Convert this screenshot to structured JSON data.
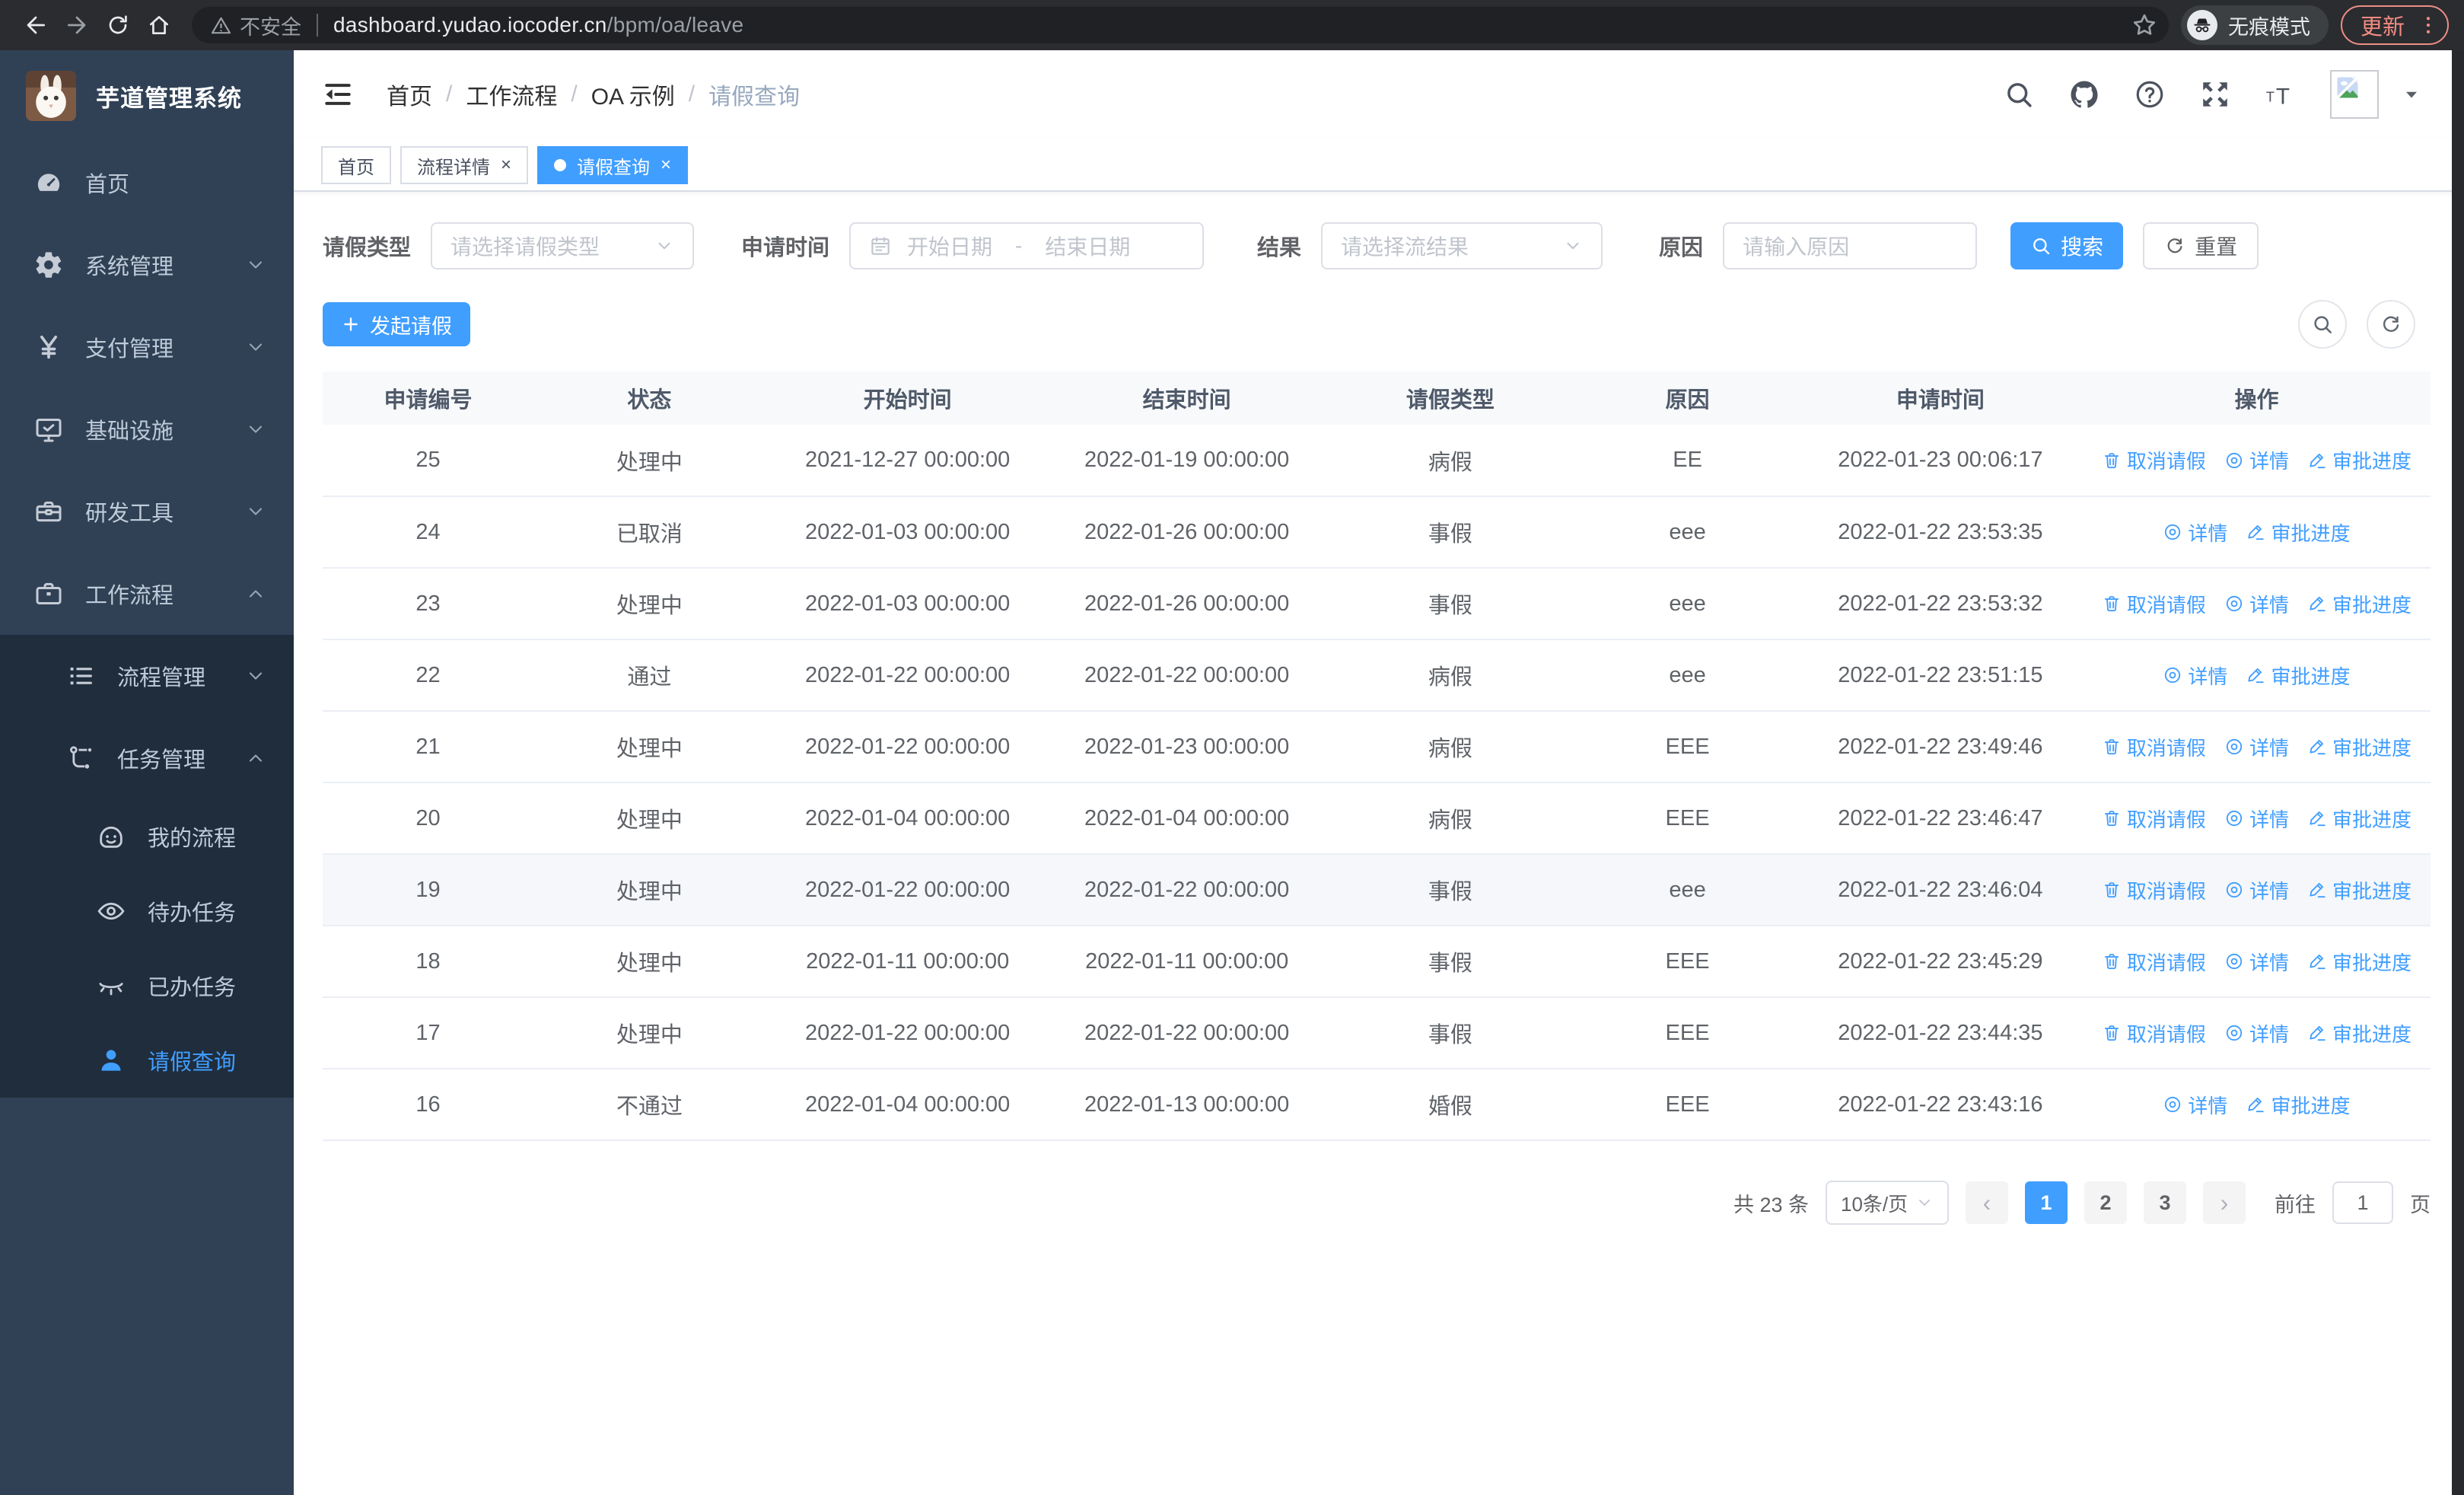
{
  "colors": {
    "primary": "#409EFF",
    "sidebar_bg": "#304156",
    "submenu_bg": "#1f2d3d",
    "update_accent": "#f28b82"
  },
  "browser": {
    "security_label": "不安全",
    "url_host": "dashboard.yudao.iocoder.cn",
    "url_path": "/bpm/oa/leave",
    "incognito_label": "无痕模式",
    "update_label": "更新"
  },
  "sidebar": {
    "title": "芋道管理系统",
    "items": [
      {
        "key": "home",
        "label": "首页",
        "icon": "dashboard-icon",
        "level": 0
      },
      {
        "key": "system",
        "label": "系统管理",
        "icon": "gear-icon",
        "level": 0,
        "chevron": "down"
      },
      {
        "key": "payment",
        "label": "支付管理",
        "icon": "yen-icon",
        "level": 0,
        "chevron": "down"
      },
      {
        "key": "infra",
        "label": "基础设施",
        "icon": "monitor-icon",
        "level": 0,
        "chevron": "down"
      },
      {
        "key": "devtools",
        "label": "研发工具",
        "icon": "toolbox-icon",
        "level": 0,
        "chevron": "down"
      },
      {
        "key": "workflow",
        "label": "工作流程",
        "icon": "briefcase-icon",
        "level": 0,
        "chevron": "up"
      },
      {
        "key": "process-mgmt",
        "label": "流程管理",
        "icon": "tree-list-icon",
        "level": 1,
        "nested": true,
        "chevron": "down"
      },
      {
        "key": "task-mgmt",
        "label": "任务管理",
        "icon": "flow-icon",
        "level": 1,
        "nested": true,
        "chevron": "up"
      },
      {
        "key": "my-process",
        "label": "我的流程",
        "icon": "face-icon",
        "level": 2,
        "nested": true
      },
      {
        "key": "todo-tasks",
        "label": "待办任务",
        "icon": "eye-open-icon",
        "level": 2,
        "nested": true
      },
      {
        "key": "done-tasks",
        "label": "已办任务",
        "icon": "eye-closed-icon",
        "level": 2,
        "nested": true
      },
      {
        "key": "leave-query",
        "label": "请假查询",
        "icon": "user-icon",
        "level": 2,
        "nested": true,
        "active": true
      }
    ]
  },
  "breadcrumb": [
    "首页",
    "工作流程",
    "OA 示例",
    "请假查询"
  ],
  "tabs": [
    {
      "label": "首页",
      "closable": false,
      "active": false
    },
    {
      "label": "流程详情",
      "closable": true,
      "active": false
    },
    {
      "label": "请假查询",
      "closable": true,
      "active": true
    }
  ],
  "filters": {
    "leave_type_label": "请假类型",
    "leave_type_placeholder": "请选择请假类型",
    "apply_time_label": "申请时间",
    "start_date_placeholder": "开始日期",
    "date_separator": "-",
    "end_date_placeholder": "结束日期",
    "result_label": "结果",
    "result_placeholder": "请选择流结果",
    "reason_label": "原因",
    "reason_placeholder": "请输入原因",
    "search_label": "搜索",
    "reset_label": "重置"
  },
  "toolbar": {
    "create_label": "发起请假"
  },
  "table": {
    "columns": [
      "申请编号",
      "状态",
      "开始时间",
      "结束时间",
      "请假类型",
      "原因",
      "申请时间",
      "操作"
    ],
    "rows": [
      {
        "id": "25",
        "status": "处理中",
        "start": "2021-12-27 00:00:00",
        "end": "2022-01-19 00:00:00",
        "type": "病假",
        "reason": "EE",
        "apply_time": "2022-01-23 00:06:17",
        "highlight": false,
        "actions": [
          {
            "label": "取消请假",
            "icon": "trash-icon"
          },
          {
            "label": "详情",
            "icon": "view-icon"
          },
          {
            "label": "审批进度",
            "icon": "progress-icon"
          }
        ]
      },
      {
        "id": "24",
        "status": "已取消",
        "start": "2022-01-03 00:00:00",
        "end": "2022-01-26 00:00:00",
        "type": "事假",
        "reason": "eee",
        "apply_time": "2022-01-22 23:53:35",
        "highlight": false,
        "actions": [
          {
            "label": "详情",
            "icon": "view-icon"
          },
          {
            "label": "审批进度",
            "icon": "progress-icon"
          }
        ]
      },
      {
        "id": "23",
        "status": "处理中",
        "start": "2022-01-03 00:00:00",
        "end": "2022-01-26 00:00:00",
        "type": "事假",
        "reason": "eee",
        "apply_time": "2022-01-22 23:53:32",
        "highlight": false,
        "actions": [
          {
            "label": "取消请假",
            "icon": "trash-icon"
          },
          {
            "label": "详情",
            "icon": "view-icon"
          },
          {
            "label": "审批进度",
            "icon": "progress-icon"
          }
        ]
      },
      {
        "id": "22",
        "status": "通过",
        "start": "2022-01-22 00:00:00",
        "end": "2022-01-22 00:00:00",
        "type": "病假",
        "reason": "eee",
        "apply_time": "2022-01-22 23:51:15",
        "highlight": false,
        "actions": [
          {
            "label": "详情",
            "icon": "view-icon"
          },
          {
            "label": "审批进度",
            "icon": "progress-icon"
          }
        ]
      },
      {
        "id": "21",
        "status": "处理中",
        "start": "2022-01-22 00:00:00",
        "end": "2022-01-23 00:00:00",
        "type": "病假",
        "reason": "EEE",
        "apply_time": "2022-01-22 23:49:46",
        "highlight": false,
        "actions": [
          {
            "label": "取消请假",
            "icon": "trash-icon"
          },
          {
            "label": "详情",
            "icon": "view-icon"
          },
          {
            "label": "审批进度",
            "icon": "progress-icon"
          }
        ]
      },
      {
        "id": "20",
        "status": "处理中",
        "start": "2022-01-04 00:00:00",
        "end": "2022-01-04 00:00:00",
        "type": "病假",
        "reason": "EEE",
        "apply_time": "2022-01-22 23:46:47",
        "highlight": false,
        "actions": [
          {
            "label": "取消请假",
            "icon": "trash-icon"
          },
          {
            "label": "详情",
            "icon": "view-icon"
          },
          {
            "label": "审批进度",
            "icon": "progress-icon"
          }
        ]
      },
      {
        "id": "19",
        "status": "处理中",
        "start": "2022-01-22 00:00:00",
        "end": "2022-01-22 00:00:00",
        "type": "事假",
        "reason": "eee",
        "apply_time": "2022-01-22 23:46:04",
        "highlight": true,
        "actions": [
          {
            "label": "取消请假",
            "icon": "trash-icon"
          },
          {
            "label": "详情",
            "icon": "view-icon"
          },
          {
            "label": "审批进度",
            "icon": "progress-icon"
          }
        ]
      },
      {
        "id": "18",
        "status": "处理中",
        "start": "2022-01-11 00:00:00",
        "end": "2022-01-11 00:00:00",
        "type": "事假",
        "reason": "EEE",
        "apply_time": "2022-01-22 23:45:29",
        "highlight": false,
        "actions": [
          {
            "label": "取消请假",
            "icon": "trash-icon"
          },
          {
            "label": "详情",
            "icon": "view-icon"
          },
          {
            "label": "审批进度",
            "icon": "progress-icon"
          }
        ]
      },
      {
        "id": "17",
        "status": "处理中",
        "start": "2022-01-22 00:00:00",
        "end": "2022-01-22 00:00:00",
        "type": "事假",
        "reason": "EEE",
        "apply_time": "2022-01-22 23:44:35",
        "highlight": false,
        "actions": [
          {
            "label": "取消请假",
            "icon": "trash-icon"
          },
          {
            "label": "详情",
            "icon": "view-icon"
          },
          {
            "label": "审批进度",
            "icon": "progress-icon"
          }
        ]
      },
      {
        "id": "16",
        "status": "不通过",
        "start": "2022-01-04 00:00:00",
        "end": "2022-01-13 00:00:00",
        "type": "婚假",
        "reason": "EEE",
        "apply_time": "2022-01-22 23:43:16",
        "highlight": false,
        "actions": [
          {
            "label": "详情",
            "icon": "view-icon"
          },
          {
            "label": "审批进度",
            "icon": "progress-icon"
          }
        ]
      }
    ]
  },
  "pagination": {
    "total_label": "共 23 条",
    "page_size_label": "10条/页",
    "prev_label": "‹",
    "pages": [
      "1",
      "2",
      "3"
    ],
    "active_page": "1",
    "next_label": "›",
    "goto_label": "前往",
    "goto_value": "1",
    "unit_label": "页"
  }
}
